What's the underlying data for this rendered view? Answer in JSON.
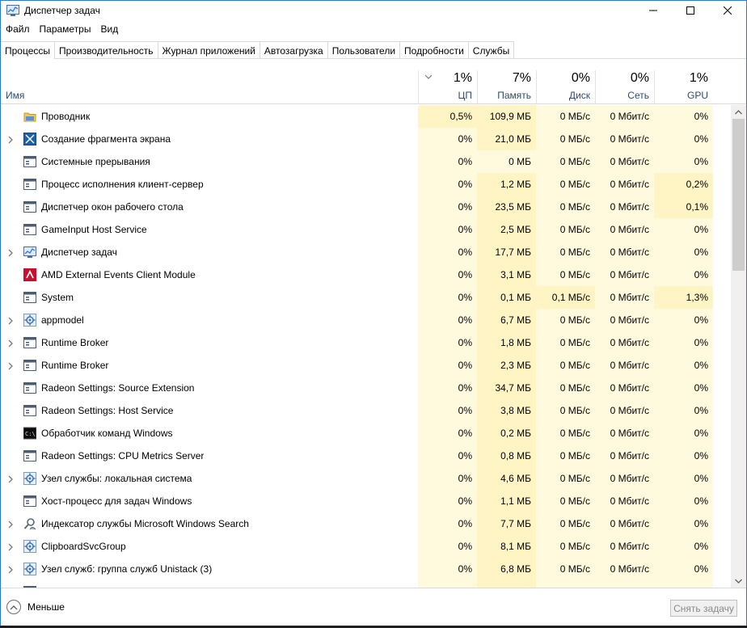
{
  "window": {
    "title": "Диспетчер задач"
  },
  "menu": [
    "Файл",
    "Параметры",
    "Вид"
  ],
  "tabs": [
    {
      "label": "Процессы",
      "active": true
    },
    {
      "label": "Производительность",
      "active": false
    },
    {
      "label": "Журнал приложений",
      "active": false
    },
    {
      "label": "Автозагрузка",
      "active": false
    },
    {
      "label": "Пользователи",
      "active": false
    },
    {
      "label": "Подробности",
      "active": false
    },
    {
      "label": "Службы",
      "active": false
    }
  ],
  "header": {
    "name_label": "Имя",
    "columns": [
      {
        "key": "cpu",
        "pct": "1%",
        "label": "ЦП"
      },
      {
        "key": "mem",
        "pct": "7%",
        "label": "Память"
      },
      {
        "key": "disk",
        "pct": "0%",
        "label": "Диск"
      },
      {
        "key": "net",
        "pct": "0%",
        "label": "Сеть"
      },
      {
        "key": "gpu",
        "pct": "1%",
        "label": "GPU"
      }
    ]
  },
  "processes": [
    {
      "name": "Проводник",
      "icon": "folder-icon",
      "expandable": false,
      "cpu": "0,5%",
      "mem": "109,9 МБ",
      "disk": "0 МБ/с",
      "net": "0 Мбит/с",
      "gpu": "0%"
    },
    {
      "name": "Создание фрагмента экрана",
      "icon": "snip-icon",
      "expandable": true,
      "cpu": "0%",
      "mem": "21,0 МБ",
      "disk": "0 МБ/с",
      "net": "0 Мбит/с",
      "gpu": "0%"
    },
    {
      "name": "Системные прерывания",
      "icon": "window-icon",
      "expandable": false,
      "cpu": "0%",
      "mem": "0 МБ",
      "disk": "0 МБ/с",
      "net": "0 Мбит/с",
      "gpu": "0%"
    },
    {
      "name": "Процесс исполнения клиент-сервер",
      "icon": "window-icon",
      "expandable": false,
      "cpu": "0%",
      "mem": "1,2 МБ",
      "disk": "0 МБ/с",
      "net": "0 Мбит/с",
      "gpu": "0,2%"
    },
    {
      "name": "Диспетчер окон рабочего стола",
      "icon": "window-icon",
      "expandable": false,
      "cpu": "0%",
      "mem": "23,5 МБ",
      "disk": "0 МБ/с",
      "net": "0 Мбит/с",
      "gpu": "0,1%"
    },
    {
      "name": "GameInput Host Service",
      "icon": "window-icon",
      "expandable": false,
      "cpu": "0%",
      "mem": "2,5 МБ",
      "disk": "0 МБ/с",
      "net": "0 Мбит/с",
      "gpu": "0%"
    },
    {
      "name": "Диспетчер задач",
      "icon": "taskmgr-icon",
      "expandable": true,
      "cpu": "0%",
      "mem": "17,7 МБ",
      "disk": "0 МБ/с",
      "net": "0 Мбит/с",
      "gpu": "0%"
    },
    {
      "name": "AMD External Events Client Module",
      "icon": "amd-icon",
      "expandable": false,
      "cpu": "0%",
      "mem": "3,1 МБ",
      "disk": "0 МБ/с",
      "net": "0 Мбит/с",
      "gpu": "0%"
    },
    {
      "name": "System",
      "icon": "window-icon",
      "expandable": false,
      "cpu": "0%",
      "mem": "0,1 МБ",
      "disk": "0,1 МБ/с",
      "net": "0 Мбит/с",
      "gpu": "1,3%"
    },
    {
      "name": "appmodel",
      "icon": "gear-icon",
      "expandable": true,
      "cpu": "0%",
      "mem": "6,7 МБ",
      "disk": "0 МБ/с",
      "net": "0 Мбит/с",
      "gpu": "0%"
    },
    {
      "name": "Runtime Broker",
      "icon": "window-icon",
      "expandable": true,
      "cpu": "0%",
      "mem": "1,8 МБ",
      "disk": "0 МБ/с",
      "net": "0 Мбит/с",
      "gpu": "0%"
    },
    {
      "name": "Runtime Broker",
      "icon": "window-icon",
      "expandable": true,
      "cpu": "0%",
      "mem": "2,3 МБ",
      "disk": "0 МБ/с",
      "net": "0 Мбит/с",
      "gpu": "0%"
    },
    {
      "name": "Radeon Settings: Source Extension",
      "icon": "window-icon",
      "expandable": false,
      "cpu": "0%",
      "mem": "34,7 МБ",
      "disk": "0 МБ/с",
      "net": "0 Мбит/с",
      "gpu": "0%"
    },
    {
      "name": "Radeon Settings: Host Service",
      "icon": "window-icon",
      "expandable": false,
      "cpu": "0%",
      "mem": "3,8 МБ",
      "disk": "0 МБ/с",
      "net": "0 Мбит/с",
      "gpu": "0%"
    },
    {
      "name": "Обработчик команд Windows",
      "icon": "cmd-icon",
      "expandable": false,
      "cpu": "0%",
      "mem": "0,2 МБ",
      "disk": "0 МБ/с",
      "net": "0 Мбит/с",
      "gpu": "0%"
    },
    {
      "name": "Radeon Settings: CPU Metrics Server",
      "icon": "window-icon",
      "expandable": false,
      "cpu": "0%",
      "mem": "0,8 МБ",
      "disk": "0 МБ/с",
      "net": "0 Мбит/с",
      "gpu": "0%"
    },
    {
      "name": "Узел службы: локальная система",
      "icon": "gear-icon",
      "expandable": true,
      "cpu": "0%",
      "mem": "4,6 МБ",
      "disk": "0 МБ/с",
      "net": "0 Мбит/с",
      "gpu": "0%"
    },
    {
      "name": "Хост-процесс для задач Windows",
      "icon": "window-icon",
      "expandable": false,
      "cpu": "0%",
      "mem": "1,1 МБ",
      "disk": "0 МБ/с",
      "net": "0 Мбит/с",
      "gpu": "0%"
    },
    {
      "name": "Индексатор службы Microsoft Windows Search",
      "icon": "search-user-icon",
      "expandable": true,
      "cpu": "0%",
      "mem": "7,7 МБ",
      "disk": "0 МБ/с",
      "net": "0 Мбит/с",
      "gpu": "0%"
    },
    {
      "name": "ClipboardSvcGroup",
      "icon": "gear-icon",
      "expandable": true,
      "cpu": "0%",
      "mem": "8,1 МБ",
      "disk": "0 МБ/с",
      "net": "0 Мбит/с",
      "gpu": "0%"
    },
    {
      "name": "Узел служб: группа служб Unistack (3)",
      "icon": "gear-icon",
      "expandable": true,
      "cpu": "0%",
      "mem": "6,8 МБ",
      "disk": "0 МБ/с",
      "net": "0 Мбит/с",
      "gpu": "0%"
    },
    {
      "name": "",
      "icon": "window-icon",
      "expandable": false,
      "cpu": "",
      "mem": "",
      "disk": "",
      "net": "",
      "gpu": ""
    }
  ],
  "footer": {
    "fewer_label": "Меньше",
    "end_task_label": "Снять задачу"
  },
  "colors": {
    "heat_low": "#fff9dd",
    "heat_mid": "#fff4c4",
    "heat_high": "#ffe9a8",
    "accent": "#2b79d8"
  }
}
